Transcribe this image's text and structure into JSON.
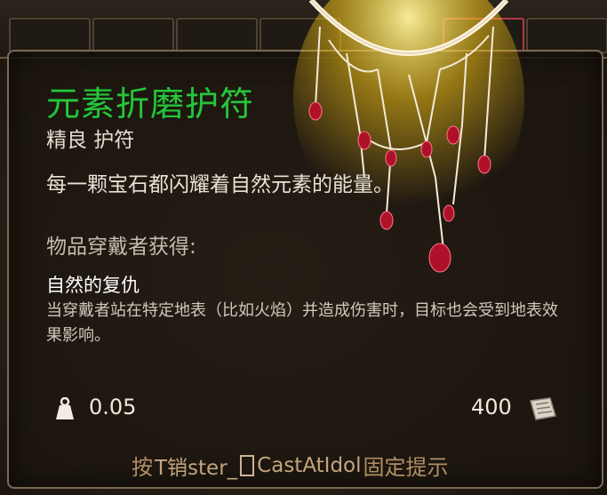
{
  "item": {
    "name": "元素折磨护符",
    "subtitle": "精良 护符",
    "description": "每一颗宝石都闪耀着自然元素的能量。",
    "gain_label": "物品穿戴者获得:",
    "skill_name": "自然的复仇",
    "skill_desc": "当穿戴者站在特定地表（比如火焰）并造成伤害时，目标也会受到地表效果影响。",
    "weight": "0.05",
    "price": "400"
  },
  "footer": {
    "hint_prefix": "按",
    "hint_key": "T销ster_",
    "hint_key2": "CastAtIdol",
    "hint_suffix": "固定提示"
  },
  "icons": {
    "weight": "weight-icon",
    "price": "coin-icon",
    "necklace": "amulet-necklace-icon"
  },
  "colors": {
    "name": "#29c43c",
    "hint": "#b08f66"
  }
}
